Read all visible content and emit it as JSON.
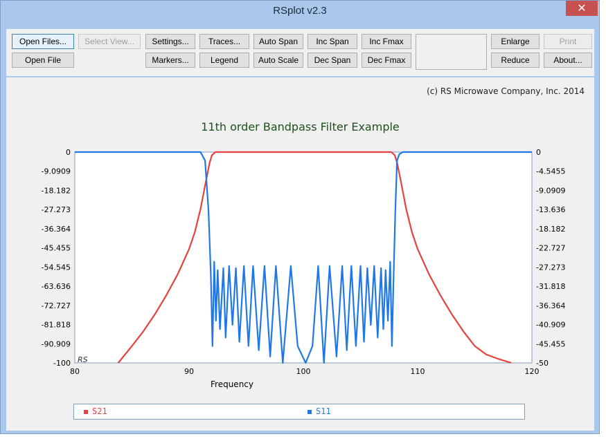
{
  "window": {
    "title": "RSplot v2.3",
    "close_glyph": "✕"
  },
  "toolbar": {
    "open_files": "Open Files...",
    "select_view": "Select View...",
    "settings": "Settings...",
    "traces": "Traces...",
    "auto_span": "Auto Span",
    "inc_span": "Inc Span",
    "inc_fmax": "Inc Fmax",
    "enlarge": "Enlarge",
    "print": "Print",
    "open_file": "Open File",
    "markers": "Markers...",
    "legend": "Legend",
    "auto_scale": "Auto Scale",
    "dec_span": "Dec Span",
    "dec_fmax": "Dec Fmax",
    "reduce": "Reduce",
    "about": "About..."
  },
  "copyright": "(c) RS Microwave Company, Inc. 2014",
  "colors": {
    "s21": "#e8403e",
    "s11": "#1f78e6",
    "title": "#1f4f1f"
  },
  "chart_data": {
    "type": "line",
    "title": "11th order Bandpass Filter Example",
    "xlabel": "Frequency",
    "watermark": "RS",
    "xlim": [
      80,
      120
    ],
    "ylim_left": [
      -100,
      0
    ],
    "ylim_right": [
      -50,
      0
    ],
    "x_ticks": [
      "80",
      "90",
      "100",
      "110",
      "120"
    ],
    "y_ticks_left": [
      "0",
      "-9.0909",
      "-18.182",
      "-27.273",
      "-36.364",
      "-45.455",
      "-54.545",
      "-63.636",
      "-72.727",
      "-81.818",
      "-90.909",
      "-100"
    ],
    "y_ticks_right": [
      "0",
      "-4.5455",
      "-9.0909",
      "-13.636",
      "-18.182",
      "-22.727",
      "-27.273",
      "-31.818",
      "-36.364",
      "-40.909",
      "-45.455",
      "-50"
    ],
    "series": [
      {
        "name": "S21",
        "axis": "left",
        "x": [
          83.8,
          85,
          86,
          87,
          88,
          89,
          90,
          90.5,
          91,
          91.5,
          91.8,
          92,
          92.3,
          100,
          107.7,
          108,
          108.2,
          108.5,
          109,
          109.5,
          110,
          111,
          112,
          113,
          114,
          115,
          116,
          117,
          118.2
        ],
        "y": [
          -100,
          -92,
          -85,
          -77,
          -68,
          -58,
          -46,
          -38,
          -27,
          -13,
          -5,
          -1.5,
          0,
          0,
          0,
          -1.5,
          -5,
          -13,
          -27,
          -38,
          -46,
          -58,
          -68,
          -77,
          -85,
          -92,
          -96,
          -98,
          -100
        ]
      },
      {
        "name": "S11",
        "axis": "left",
        "x": [
          80,
          91,
          91.4,
          91.7,
          91.9,
          92.05,
          92.2,
          92.35,
          92.5,
          92.7,
          93.0,
          93.2,
          93.5,
          93.8,
          94.1,
          94.4,
          94.8,
          95.2,
          95.6,
          96.1,
          96.6,
          97.1,
          97.6,
          98.2,
          98.9,
          99.5,
          100.2,
          100.8,
          101.3,
          101.8,
          102.3,
          102.9,
          103.4,
          103.8,
          104.2,
          104.6,
          105.0,
          105.3,
          105.6,
          105.9,
          106.2,
          106.5,
          106.8,
          107.0,
          107.2,
          107.4,
          107.6,
          107.75,
          107.9,
          108.05,
          108.2,
          108.4,
          108.7,
          109.2,
          120
        ],
        "y": [
          0,
          0,
          -4,
          -28,
          -58,
          -92,
          -52,
          -80,
          -56,
          -84,
          -55,
          -88,
          -54,
          -82,
          -55,
          -90,
          -54,
          -92,
          -54,
          -94,
          -54,
          -97,
          -54,
          -100,
          -54,
          -92,
          -112,
          -92,
          -54,
          -100,
          -54,
          -97,
          -54,
          -94,
          -54,
          -92,
          -54,
          -90,
          -55,
          -82,
          -54,
          -88,
          -55,
          -84,
          -56,
          -80,
          -52,
          -92,
          -58,
          -28,
          -4,
          -1,
          0,
          0,
          0
        ]
      }
    ],
    "legend": [
      {
        "name": "S21",
        "color": "#e8403e"
      },
      {
        "name": "S11",
        "color": "#1f78e6"
      }
    ],
    "legend_placement": "bottom",
    "grid": false
  }
}
